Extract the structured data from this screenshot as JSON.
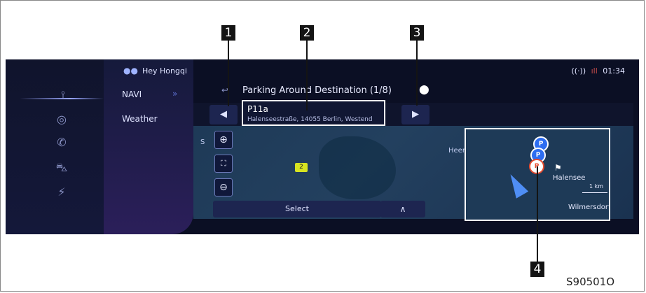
{
  "status_bar": {
    "voice_assistant": "Hey Hongqi",
    "time": "01:34",
    "wifi_glyph": "((·))",
    "signal_glyph": "ıll"
  },
  "sidebar": {
    "icons": [
      "navigation-icon",
      "speedometer-icon",
      "phone-icon",
      "car-icon",
      "charging-icon"
    ]
  },
  "nav_panel": {
    "items": [
      {
        "label": "NAVI"
      },
      {
        "label": "Weather"
      }
    ],
    "chevron": "»"
  },
  "header": {
    "title": "Parking Around Destination (1/8)"
  },
  "destination_card": {
    "name": "P11a",
    "address": "Halenseestraße, 14055 Berlin, Westend"
  },
  "buttons": {
    "prev": "◀",
    "next": "▶",
    "select": "Select",
    "expand": "∧",
    "zoom_in": "⊕",
    "fullscreen": "⛶",
    "zoom_out": "⊖"
  },
  "map": {
    "street_label": "Heerstraße",
    "marker_label": "2",
    "map_prefix": "S"
  },
  "overview_map": {
    "place": "Halensee",
    "district": "Wilmersdorf",
    "scale": "1 km",
    "poi_letter": "P"
  },
  "callouts": [
    "1",
    "2",
    "3",
    "4"
  ],
  "figure_id": "S90501O"
}
